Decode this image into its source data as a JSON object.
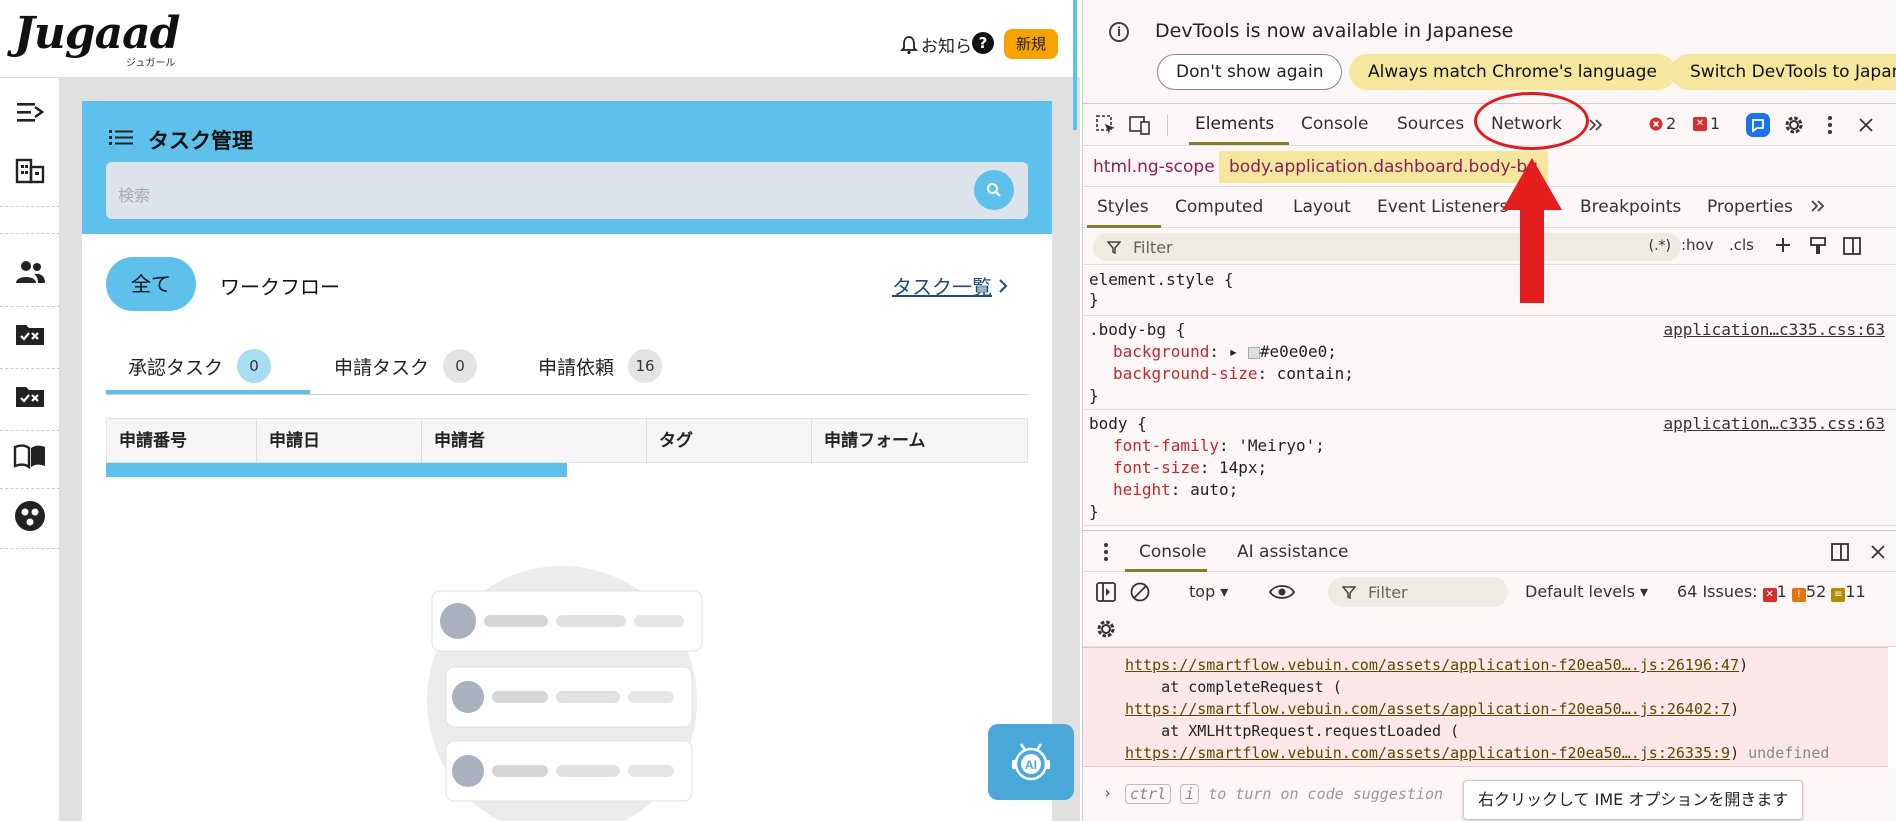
{
  "app": {
    "logo_text": "Jugaad",
    "logo_sub": "ジュガール",
    "notice_label": "お知ら",
    "new_label": "新規",
    "task_title": "タスク管理",
    "search_placeholder": "検索",
    "filters": {
      "all": "全て",
      "workflow": "ワークフロー"
    },
    "task_list_link": "タスク一覧",
    "tabs": [
      {
        "label": "承認タスク",
        "count": "0"
      },
      {
        "label": "申請タスク",
        "count": "0"
      },
      {
        "label": "申請依頼",
        "count": "16"
      }
    ],
    "table_headers": [
      "申請番号",
      "申請日",
      "申請者",
      "タグ",
      "申請フォーム"
    ],
    "loading_progress": 0.5,
    "ai_button_label": "AI",
    "accent_color": "#5ec1ec"
  },
  "devtools": {
    "info_text": "DevTools is now available in Japanese",
    "info_buttons": [
      "Don't show again",
      "Always match Chrome's language",
      "Switch DevTools to Japanese"
    ],
    "tabs": [
      "Elements",
      "Console",
      "Sources",
      "Network"
    ],
    "errors_count": "2",
    "warnings_count": "1",
    "breadcrumb_html": "html.ng-scope",
    "breadcrumb_body": "body.application.dashboard.body-bg",
    "style_tabs": [
      "Styles",
      "Computed",
      "Layout",
      "Event Listeners",
      "Breakpoints",
      "Properties"
    ],
    "filter_placeholder": "Filter",
    "filter_tools": [
      ":hov",
      ".cls"
    ],
    "filter_regex": "(.*)",
    "rules": {
      "element_style": "element.style {",
      "close": "}",
      "body_bg_selector": ".body-bg {",
      "body_bg_source": "application…c335.css:63",
      "body_bg_props": [
        {
          "name": "background",
          "value": "#e0e0e0;"
        },
        {
          "name": "background-size",
          "value": "contain;"
        }
      ],
      "body_selector": "body {",
      "body_source": "application…c335.css:63",
      "body_props": [
        {
          "name": "font-family",
          "value": "'Meiryo';"
        },
        {
          "name": "font-size",
          "value": "14px;"
        },
        {
          "name": "height",
          "value": "auto;"
        }
      ]
    },
    "drawer_tabs": [
      "Console",
      "AI assistance"
    ],
    "console_context": "top",
    "console_filter": "Filter",
    "log_levels": "Default levels",
    "issues_label": "64 Issues:",
    "issues_errors": "1",
    "issues_warnings": "52",
    "issues_info": "11",
    "log_lines": [
      {
        "prefix": "",
        "link": "https://smartflow.vebuin.com/assets/application-f20ea50….js:26196:47",
        "suffix": ")"
      },
      {
        "prefix": "    at completeRequest (",
        "link": "",
        "suffix": ""
      },
      {
        "prefix": "",
        "link": "https://smartflow.vebuin.com/assets/application-f20ea50….js:26402:7",
        "suffix": ")"
      },
      {
        "prefix": "    at XMLHttpRequest.requestLoaded (",
        "link": "",
        "suffix": ""
      },
      {
        "prefix": "",
        "link": "https://smartflow.vebuin.com/assets/application-f20ea50….js:26335:9",
        "suffix": ")",
        "tail": "undefined"
      }
    ],
    "prompt_key1": "ctrl",
    "prompt_key2": "i",
    "prompt_hint": "to turn on code suggestion",
    "ime_tooltip": "右クリックして IME オプションを開きます"
  }
}
